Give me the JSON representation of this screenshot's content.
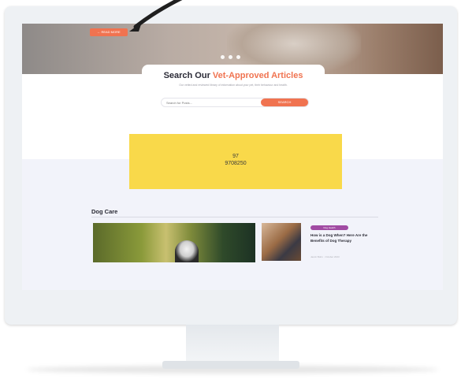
{
  "hero": {
    "tag_label": "← READ MORE",
    "carousel_dots": 3
  },
  "search": {
    "title_plain": "Search Our ",
    "title_accent": "Vet-Approved Articles",
    "description": "Our vetted and reviewed library of information about your pet, their behaviour and health.",
    "placeholder": "Search for Posts...",
    "button_label": "SEARCH"
  },
  "ad": {
    "line1": "97",
    "line2": "9708250"
  },
  "dog_care": {
    "heading": "Dog Care",
    "article": {
      "badge": "Dog Health",
      "title": "How is a Dog When? Here Are the Benefits of Dog Therapy",
      "meta": "Jacob Bohn · October 2023"
    }
  },
  "colors": {
    "accent": "#f07350",
    "ad_yellow": "#f9d94a",
    "badge_purple": "#a14ba3"
  }
}
